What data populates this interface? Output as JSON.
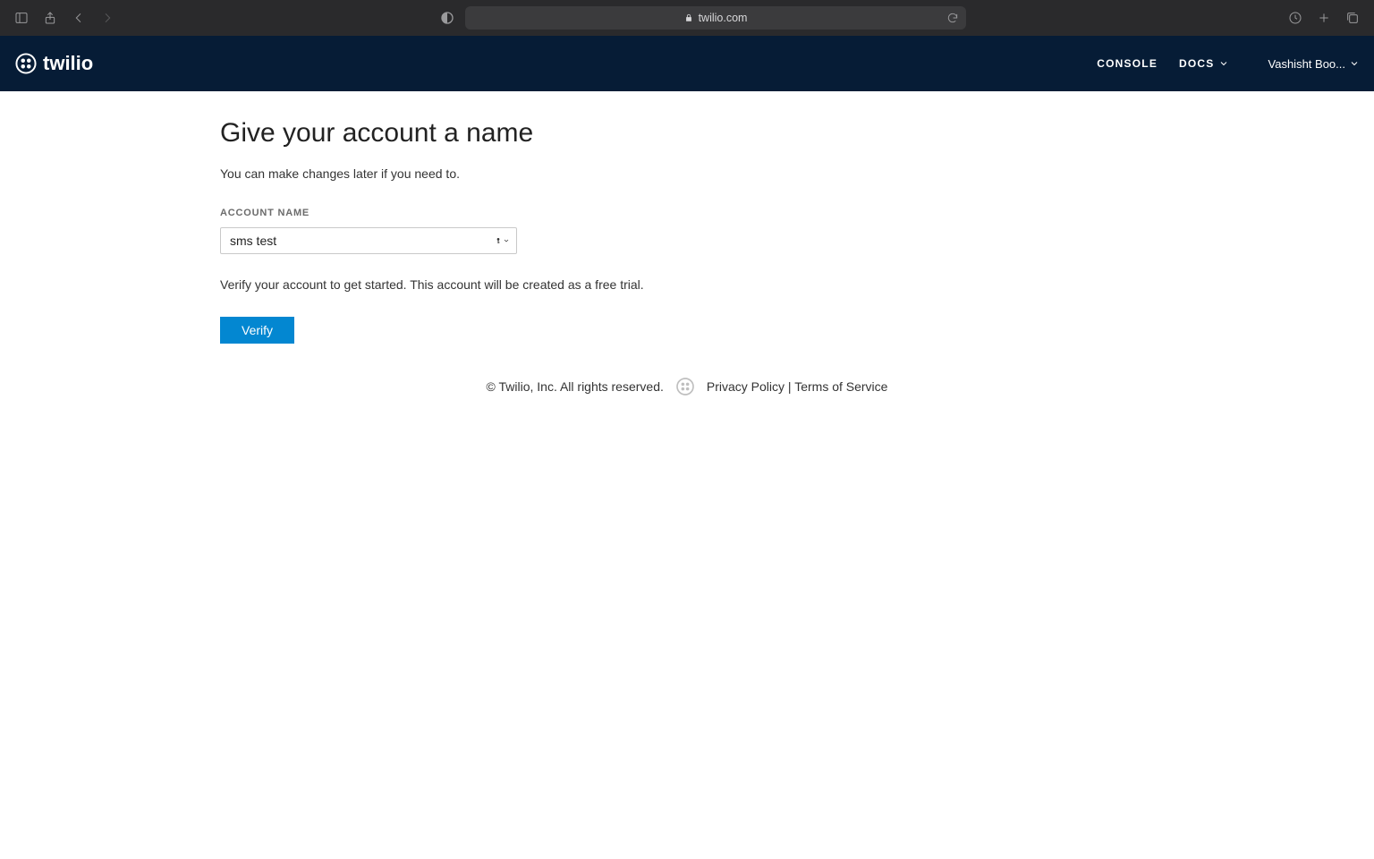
{
  "browser": {
    "url_display": "twilio.com"
  },
  "header": {
    "logo_text": "twilio",
    "nav": {
      "console": "CONSOLE",
      "docs": "DOCS"
    },
    "user_label": "Vashisht Boo..."
  },
  "main": {
    "title": "Give your account a name",
    "subtext": "You can make changes later if you need to.",
    "form": {
      "account_name_label": "ACCOUNT NAME",
      "account_name_value": "sms test"
    },
    "help_text": "Verify your account to get started. This account will be created as a free trial.",
    "verify_button": "Verify"
  },
  "footer": {
    "copyright": "© Twilio, Inc. All rights reserved.",
    "privacy": "Privacy Policy",
    "separator": " | ",
    "terms": "Terms of Service"
  }
}
